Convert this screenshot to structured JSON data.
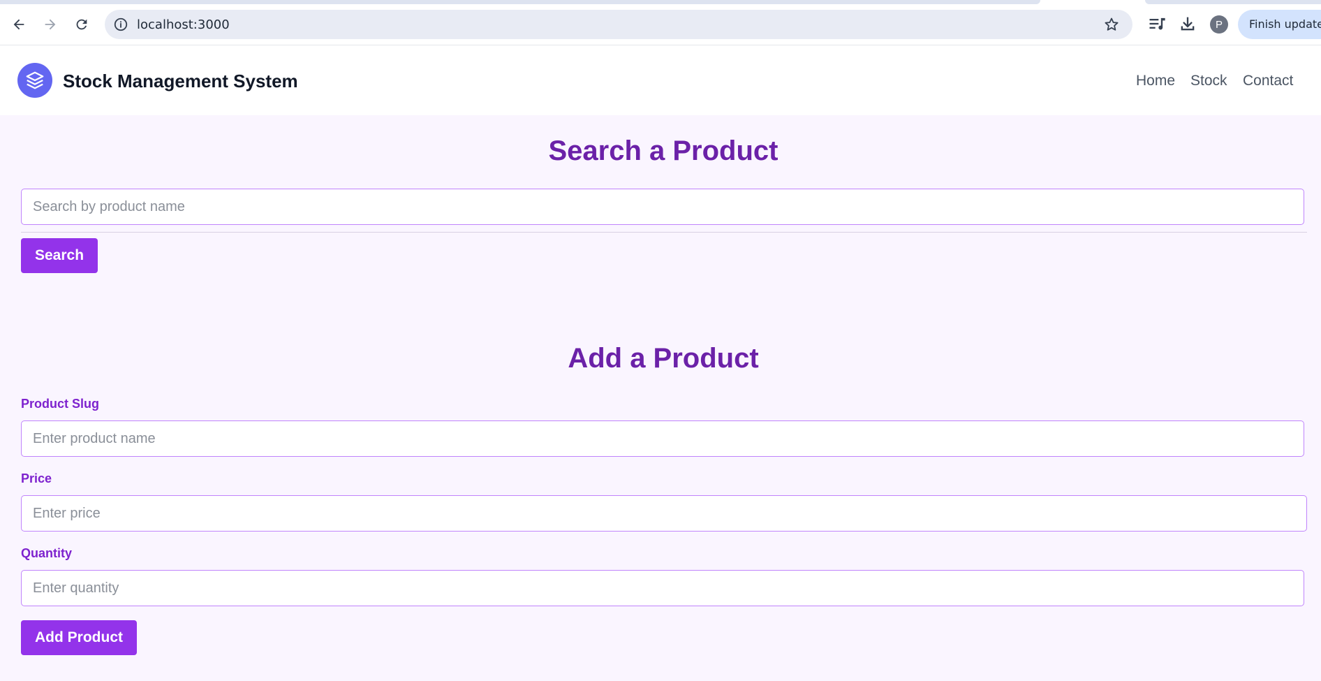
{
  "browser": {
    "url": "localhost:3000",
    "update_button": "Finish update",
    "profile_initial": "P"
  },
  "header": {
    "brand": "Stock Management System",
    "nav": [
      "Home",
      "Stock",
      "Contact"
    ]
  },
  "search": {
    "title": "Search a Product",
    "placeholder": "Search by product name",
    "button": "Search"
  },
  "add": {
    "title": "Add a Product",
    "fields": [
      {
        "label": "Product Slug",
        "placeholder": "Enter product name"
      },
      {
        "label": "Price",
        "placeholder": "Enter price"
      },
      {
        "label": "Quantity",
        "placeholder": "Enter quantity"
      }
    ],
    "button": "Add Product"
  },
  "colors": {
    "accent": "#9333ea",
    "heading": "#6b21a8",
    "label": "#7e22ce",
    "logo": "#6366f1",
    "page_bg": "#faf5ff"
  }
}
